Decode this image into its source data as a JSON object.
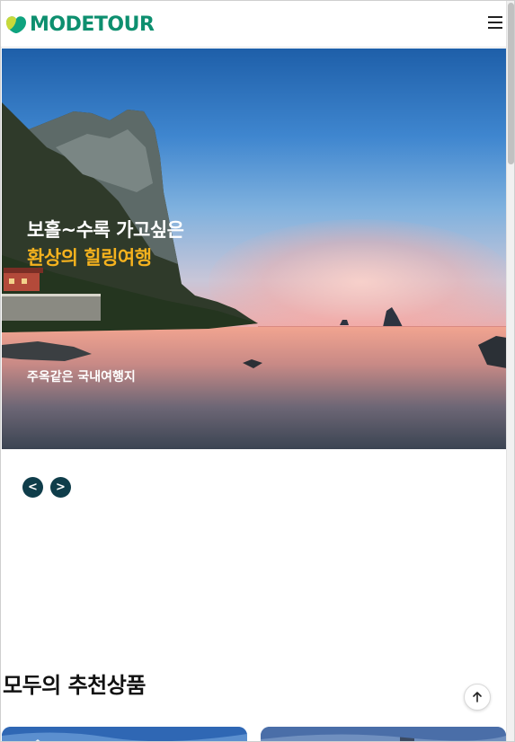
{
  "header": {
    "logo_text": "MODETOUR",
    "brand_color": "#0d8f6f",
    "menu_icon": "hamburger-icon"
  },
  "hero": {
    "line1": "보홀~수록 가고싶은",
    "line2": "환상의 힐링여행",
    "subtitle": "주옥같은 국내여행지",
    "line2_color": "#f5b21e"
  },
  "slider": {
    "prev_label": "<",
    "next_label": ">"
  },
  "section": {
    "title": "모두의 추천상품"
  },
  "floating": {
    "top_icon": "arrow-up-icon"
  }
}
